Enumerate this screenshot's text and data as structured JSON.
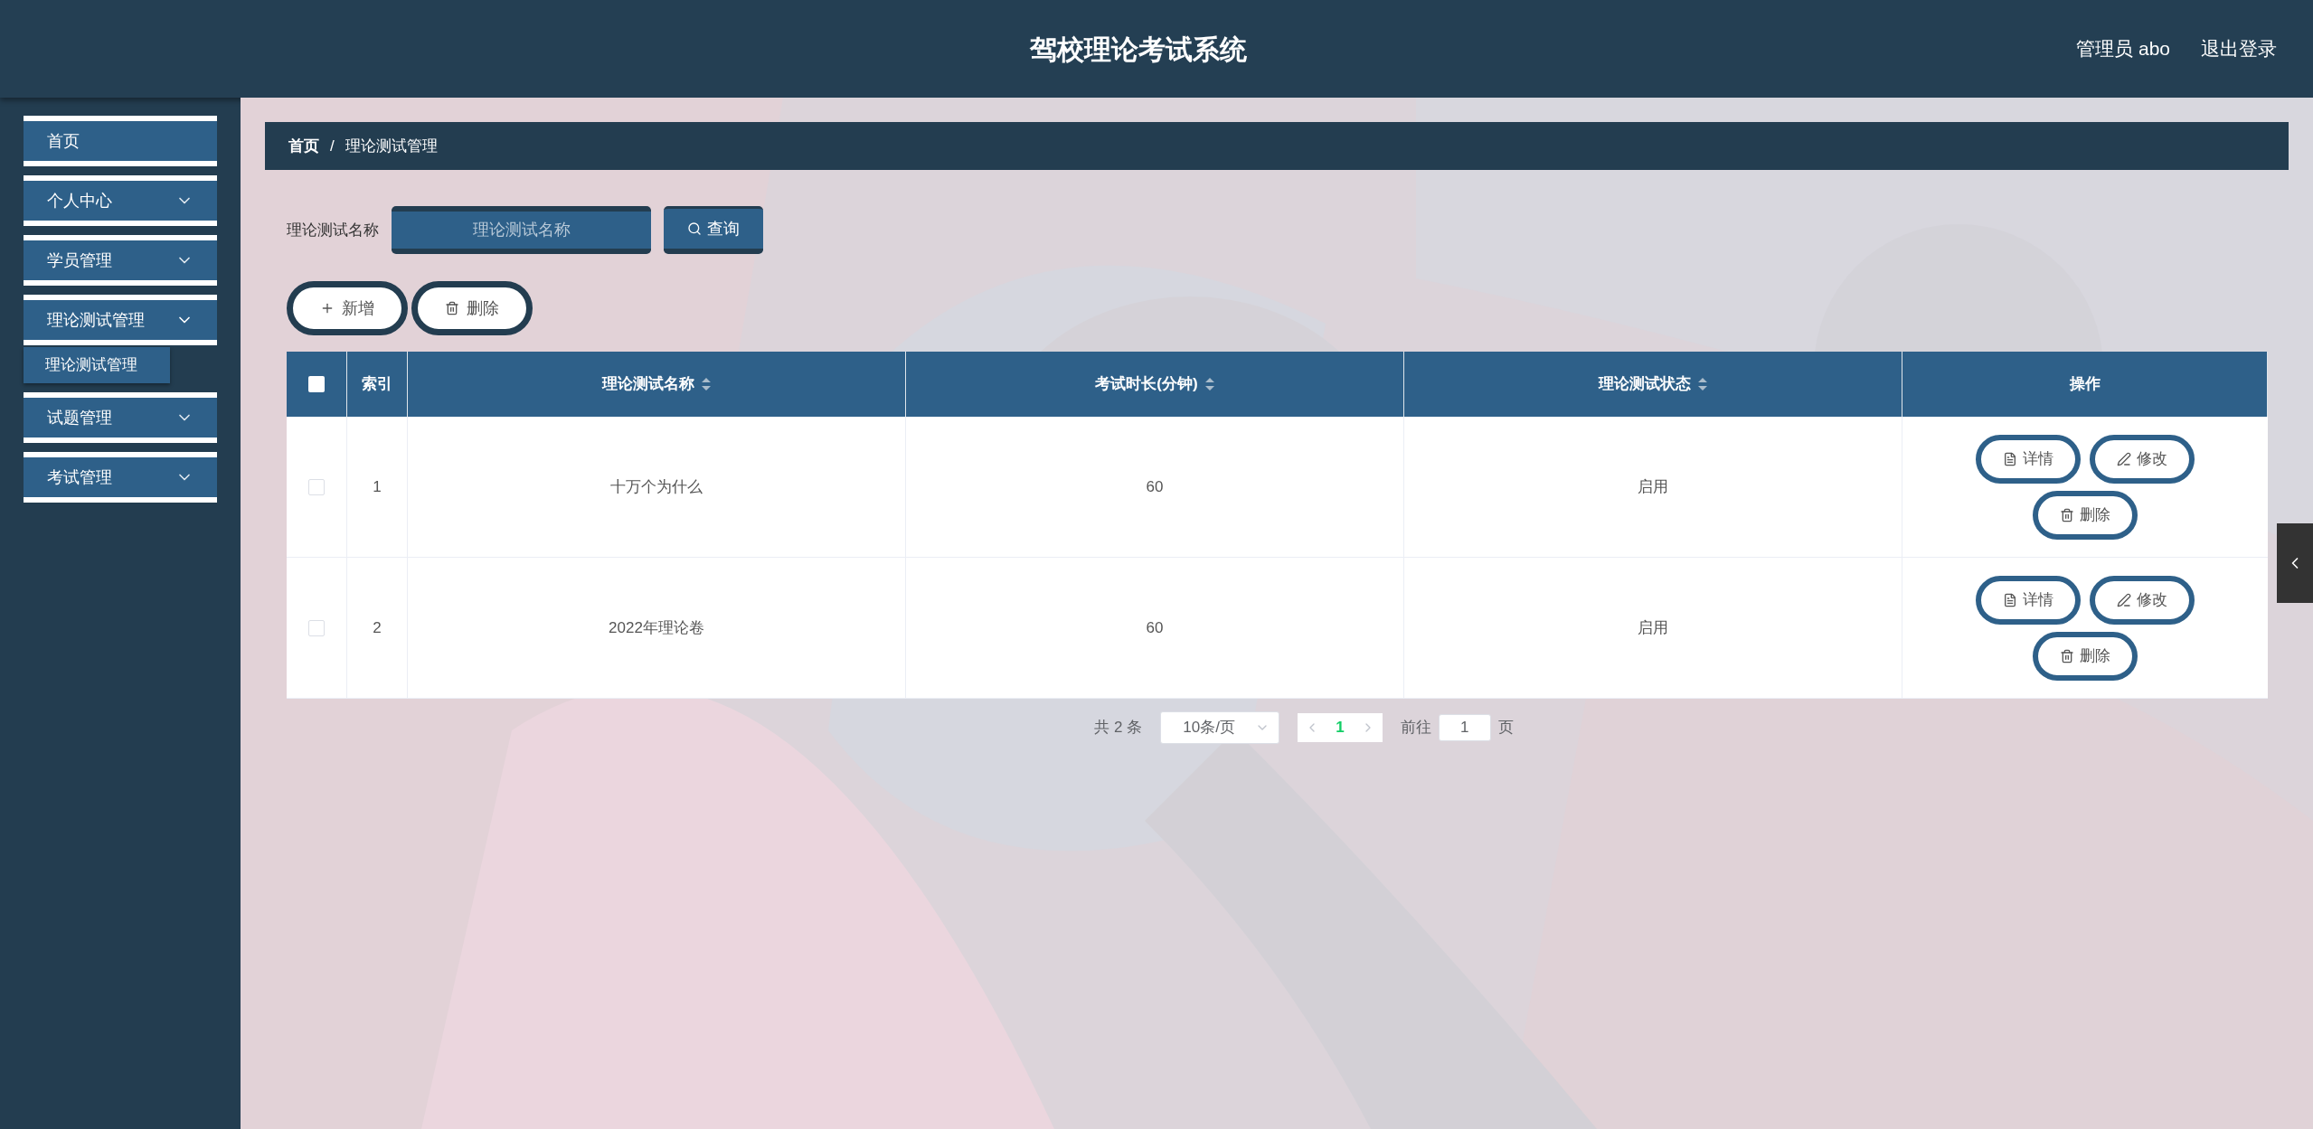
{
  "header": {
    "title": "驾校理论考试系统",
    "user": "管理员 abo",
    "logout": "退出登录"
  },
  "sidebar": {
    "items": [
      {
        "label": "首页",
        "kind": "link"
      },
      {
        "label": "个人中心",
        "kind": "menu",
        "expanded": false
      },
      {
        "label": "学员管理",
        "kind": "menu",
        "expanded": false
      },
      {
        "label": "理论测试管理",
        "kind": "menu",
        "expanded": true,
        "children": [
          {
            "label": "理论测试管理"
          }
        ]
      },
      {
        "label": "试题管理",
        "kind": "menu",
        "expanded": false
      },
      {
        "label": "考试管理",
        "kind": "menu",
        "expanded": false
      }
    ]
  },
  "breadcrumb": [
    "首页",
    "/",
    "理论测试管理"
  ],
  "search": {
    "label": "理论测试名称",
    "placeholder": "理论测试名称",
    "button": "查询"
  },
  "actions": [
    {
      "label": "新增",
      "kind": "add"
    },
    {
      "label": "删除",
      "kind": "delete"
    }
  ],
  "table": {
    "select_all_checked": false,
    "columns": [
      {
        "label": "索引",
        "sortable": false
      },
      {
        "label": "理论测试名称",
        "sortable": true
      },
      {
        "label": "考试时长(分钟)",
        "sortable": true
      },
      {
        "label": "理论测试状态",
        "sortable": true
      },
      {
        "label": "操作",
        "sortable": false
      }
    ],
    "rows": [
      {
        "checked": false,
        "cells": [
          "1",
          "十万个为什么",
          "60",
          "启用"
        ],
        "buttons": [
          {
            "label": "详情",
            "kind": "detail"
          },
          {
            "label": "修改",
            "kind": "edit"
          },
          {
            "label": "删除",
            "kind": "delete"
          }
        ]
      },
      {
        "checked": false,
        "cells": [
          "2",
          "2022年理论卷",
          "60",
          "启用"
        ],
        "buttons": [
          {
            "label": "详情",
            "kind": "detail"
          },
          {
            "label": "修改",
            "kind": "edit"
          },
          {
            "label": "删除",
            "kind": "delete"
          }
        ]
      }
    ]
  },
  "pagination": {
    "total": "共 2 条",
    "page_size": "10条/页",
    "pages": [
      {
        "label": "1",
        "selected": true
      }
    ],
    "goto_label": "前往",
    "goto_value": "1",
    "goto_suffix": "页"
  }
}
